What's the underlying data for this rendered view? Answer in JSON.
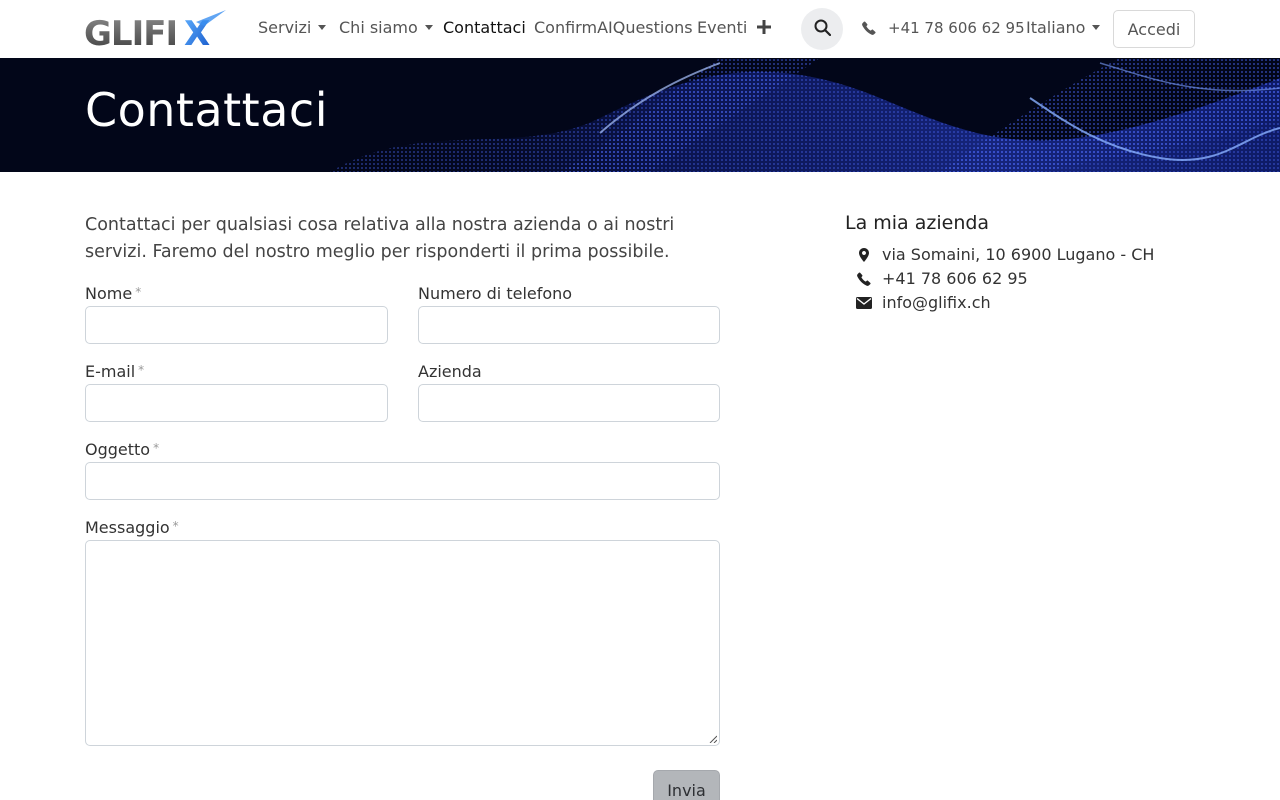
{
  "header": {
    "logo_text": "GLIFIX",
    "nav": [
      {
        "label": "Servizi",
        "dropdown": true
      },
      {
        "label": "Chi siamo",
        "dropdown": true
      },
      {
        "label": "Contattaci",
        "active": true
      },
      {
        "label": "ConfirmAIQuestions"
      },
      {
        "label": "Eventi"
      }
    ],
    "add_icon": "plus-icon",
    "search_icon": "search-icon",
    "phone": "+41 78 606 62 95",
    "language": "Italiano",
    "login": "Accedi"
  },
  "banner": {
    "title": "Contattaci"
  },
  "intro": {
    "text": "Contattaci per qualsiasi cosa relativa alla nostra azienda o ai nostri servizi. Faremo del nostro meglio per risponderti il prima possibile."
  },
  "form": {
    "name_label": "Nome",
    "phone_label": "Numero di telefono",
    "email_label": "E-mail",
    "company_label": "Azienda",
    "subject_label": "Oggetto",
    "message_label": "Messaggio",
    "required_mark": "*",
    "name_value": "",
    "phone_value": "",
    "email_value": "",
    "company_value": "",
    "subject_value": "",
    "message_value": "",
    "submit_label": "Invia"
  },
  "company": {
    "title": "La mia azienda",
    "address": "via Somaini, 10 6900 Lugano - CH",
    "phone": "+41 78 606 62 95",
    "email": "info@glifix.ch"
  },
  "colors": {
    "banner_bg": "#020619",
    "wave_blue": "#2a3fd4",
    "logo_gray": "#555555",
    "logo_blue": "#1e6fd9",
    "submit_bg": "#b3b6ba"
  }
}
